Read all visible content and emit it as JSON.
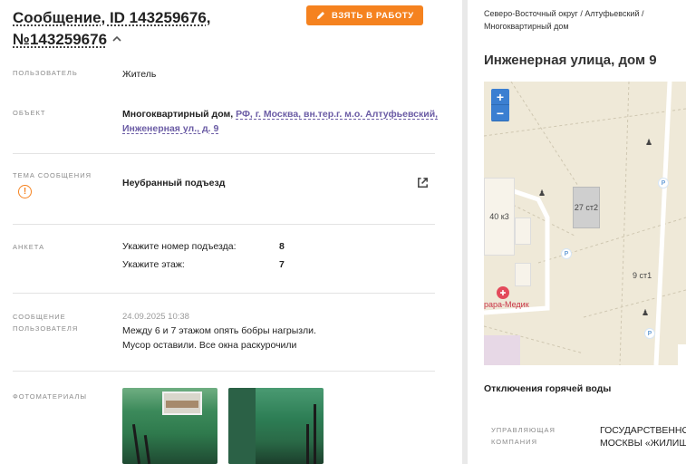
{
  "header": {
    "title_line1": "Сообщение, ID 143259676,",
    "title_line2": "№143259676",
    "take_button": "ВЗЯТЬ В РАБОТУ"
  },
  "fields": {
    "user": {
      "label": "ПОЛЬЗОВАТЕЛЬ",
      "value": "Житель"
    },
    "object": {
      "label": "ОБЪЕКТ",
      "type": "Многоквартирный дом,",
      "address_link": "РФ, г. Москва, вн.тер.г. м.о. Алтуфьевский,",
      "address_link2": "Инженерная ул., д. 9"
    },
    "topic": {
      "label": "ТЕМА СООБЩЕНИЯ",
      "value": "Неубранный подъезд"
    },
    "survey": {
      "label": "АНКЕТА",
      "items": [
        {
          "key": "Укажите номер подъезда:",
          "value": "8"
        },
        {
          "key": "Укажите этаж:",
          "value": "7"
        }
      ]
    },
    "message": {
      "label_line1": "СООБЩЕНИЕ",
      "label_line2": "ПОЛЬЗОВАТЕЛЯ",
      "date": "24.09.2025 10:38",
      "text_line1": "Между 6 и 7 этажом опять бобры нагрызли.",
      "text_line2": "Мусор оставили. Все окна раскурочили"
    },
    "photos": {
      "label": "ФОТОМАТЕРИАЛЫ"
    }
  },
  "right_panel": {
    "breadcrumb_line1": "Северо-Восточный округ / Алтуфьевский /",
    "breadcrumb_line2": "Многоквартирный дом",
    "address_title": "Инженерная улица, дом 9",
    "map": {
      "zoom_in": "+",
      "zoom_out": "−",
      "buildings": [
        "40 к3",
        "27 ст2",
        "9 ст1"
      ],
      "poi_label": "рара-Медик"
    },
    "section_title": "Отключения горячей воды",
    "company_label_line1": "УПРАВЛЯЮЩАЯ",
    "company_label_line2": "КОМПАНИЯ",
    "company_value_line1": "ГОСУДАРСТВЕННО",
    "company_value_line2": "МОСКВЫ «ЖИЛИШ"
  },
  "colors": {
    "accent_orange": "#f5821f",
    "link_purple": "#6b5ca5",
    "map_bg": "#efe9d8"
  }
}
